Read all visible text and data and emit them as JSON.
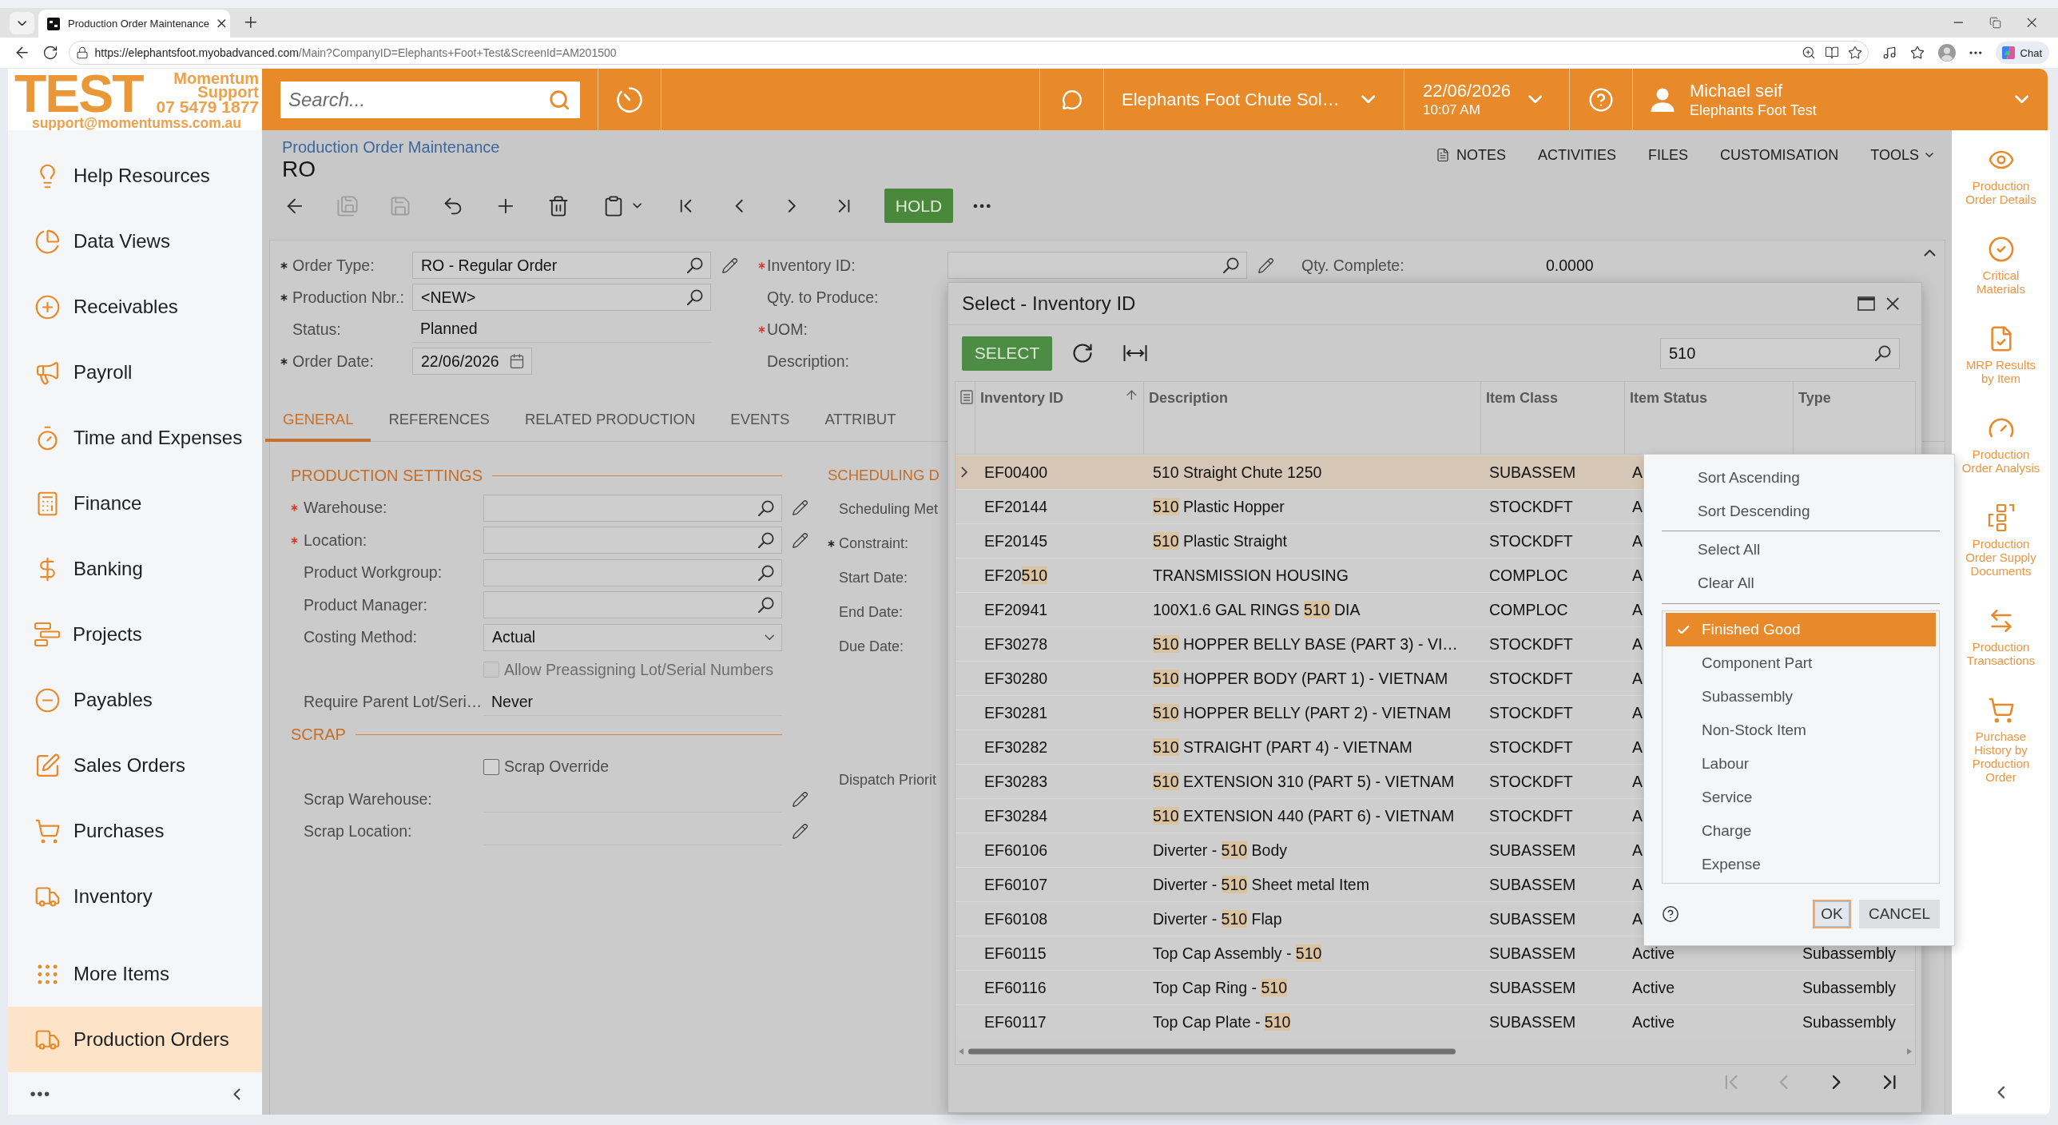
{
  "browser": {
    "tab": {
      "title": "Production Order Maintenance",
      "selected": true
    },
    "address": {
      "host": "https://elephantsfoot.myobadvanced.com",
      "path": "/Main?CompanyID=Elephants+Foot+Test&ScreenId=AM201500"
    },
    "chat_button": "Chat"
  },
  "logo": {
    "wordmark": "TEST",
    "lines": [
      "Momentum",
      "Support",
      "07 5479 1877"
    ],
    "email": "support@momentumss.com.au"
  },
  "top_bar": {
    "search": {
      "placeholder": "Search..."
    },
    "company": "Elephants Foot Chute Sol…",
    "date": "22/06/2026",
    "time": "10:07 AM",
    "user": {
      "name": "Michael seif",
      "company": "Elephants Foot Test"
    }
  },
  "sidebar": {
    "items": [
      {
        "label": "Help Resources",
        "selected": false
      },
      {
        "label": "Data Views",
        "selected": false
      },
      {
        "label": "Receivables",
        "selected": false
      },
      {
        "label": "Payroll",
        "selected": false
      },
      {
        "label": "Time and Expenses",
        "selected": false
      },
      {
        "label": "Finance",
        "selected": false
      },
      {
        "label": "Banking",
        "selected": false
      },
      {
        "label": "Projects",
        "selected": false
      },
      {
        "label": "Payables",
        "selected": false
      },
      {
        "label": "Sales Orders",
        "selected": false
      },
      {
        "label": "Purchases",
        "selected": false
      },
      {
        "label": "Inventory",
        "selected": false
      }
    ],
    "bottom_items": [
      {
        "label": "More Items",
        "selected": false
      },
      {
        "label": "Production Orders",
        "selected": true
      }
    ]
  },
  "screen": {
    "breadcrumb": "Production Order Maintenance",
    "title": "RO",
    "links": [
      {
        "label": "NOTES",
        "has_menu": false
      },
      {
        "label": "ACTIVITIES",
        "has_menu": false
      },
      {
        "label": "FILES",
        "has_menu": false
      },
      {
        "label": "CUSTOMISATION",
        "has_menu": false
      },
      {
        "label": "TOOLS",
        "has_menu": true
      }
    ],
    "toolbar": {
      "buttons": [
        {
          "disabled": false
        },
        {
          "disabled": true
        },
        {
          "disabled": true
        },
        {
          "disabled": false
        },
        {
          "disabled": false
        },
        {
          "disabled": false
        },
        {
          "disabled": false
        },
        {
          "disabled": false
        },
        {
          "disabled": false
        },
        {
          "disabled": false
        },
        {
          "disabled": false
        }
      ],
      "hold_button": "HOLD"
    },
    "header": {
      "columns": [
        {
          "fields": [
            {
              "label": "Order Type:",
              "required": true,
              "missing": false,
              "kind": "lookup",
              "value": "RO - Regular Order",
              "edit": true
            },
            {
              "label": "Production Nbr.:",
              "required": true,
              "missing": false,
              "kind": "lookup",
              "value": "<NEW>",
              "edit": false
            },
            {
              "label": "Status:",
              "required": false,
              "kind": "text",
              "value": "Planned",
              "edit": false
            },
            {
              "label": "Order Date:",
              "required": true,
              "missing": false,
              "kind": "date",
              "value": "22/06/2026",
              "edit": false
            }
          ]
        },
        {
          "fields": [
            {
              "label": "Inventory ID:",
              "required": true,
              "missing": true,
              "kind": "lookup",
              "edit": true
            },
            {
              "label": "Qty. to Produce:",
              "required": false,
              "kind": "label",
              "edit": false
            },
            {
              "label": "UOM:",
              "required": true,
              "missing": true,
              "kind": "label",
              "edit": false
            },
            {
              "label": "Description:",
              "required": false,
              "kind": "label",
              "edit": false
            }
          ]
        },
        {
          "fields": [
            {
              "label": "Qty. Complete:",
              "required": false,
              "kind": "value",
              "value": "0.0000",
              "edit": false
            }
          ]
        }
      ]
    },
    "tabs": [
      {
        "label": "GENERAL",
        "selected": true
      },
      {
        "label": "REFERENCES",
        "selected": false
      },
      {
        "label": "RELATED PRODUCTION",
        "selected": false
      },
      {
        "label": "EVENTS",
        "selected": false
      },
      {
        "label": "ATTRIBUT",
        "selected": false
      }
    ],
    "general": {
      "sections": [
        {
          "title": "PRODUCTION SETTINGS",
          "fields": [
            {
              "label": "Warehouse:",
              "required": true,
              "missing": true,
              "kind": "lookup",
              "edit": true
            },
            {
              "label": "Location:",
              "required": true,
              "missing": true,
              "kind": "lookup",
              "edit": true
            },
            {
              "label": "Product Workgroup:",
              "required": false,
              "kind": "lookup",
              "edit": false
            },
            {
              "label": "Product Manager:",
              "required": false,
              "kind": "lookup",
              "edit": false
            },
            {
              "label": "Costing Method:",
              "required": false,
              "kind": "select",
              "value": "Actual",
              "edit": false
            },
            {
              "label": "Allow Preassigning Lot/Serial Numbers",
              "required": false,
              "kind": "checkbox",
              "checked": false,
              "disabled": true,
              "edit": false
            },
            {
              "label": "Require Parent Lot/Seri…",
              "required": false,
              "kind": "text",
              "value": "Never",
              "edit": false
            }
          ]
        },
        {
          "title": "SCRAP",
          "fields": [
            {
              "label": "Scrap Override",
              "required": false,
              "kind": "checkbox",
              "checked": false,
              "disabled": false,
              "edit": false
            },
            {
              "label": "Scrap Warehouse:",
              "required": false,
              "kind": "text",
              "edit": true
            },
            {
              "label": "Scrap Location:",
              "required": false,
              "kind": "text",
              "edit": true
            }
          ]
        }
      ],
      "scheduling": {
        "title": "SCHEDULING D",
        "fields": [
          {
            "label": "Scheduling Met",
            "required": false
          },
          {
            "label": "Constraint:",
            "required": true,
            "missing": false
          },
          {
            "label": "Start Date:",
            "required": false
          },
          {
            "label": "End Date:",
            "required": false
          },
          {
            "label": "Due Date:",
            "required": false
          }
        ],
        "lower_fields": [
          {
            "label": "Dispatch Priorit",
            "required": false
          }
        ]
      }
    }
  },
  "dialog": {
    "title": "Select - Inventory ID",
    "select_button": "SELECT",
    "search": {
      "value": "510"
    },
    "columns": [
      {
        "label": "Inventory ID",
        "sorted": true
      },
      {
        "label": "Description",
        "sorted": false
      },
      {
        "label": "Item Class",
        "sorted": false
      },
      {
        "label": "Item Status",
        "sorted": false
      },
      {
        "label": "Type",
        "sorted": false
      }
    ],
    "rows": [
      {
        "selected": true,
        "inventory_id": "EF00400",
        "description": "510 Straight Chute 1250",
        "item_class": "SUBASSEM",
        "item_status": "A"
      },
      {
        "selected": false,
        "inventory_id": "EF20144",
        "description": [
          {
            "text": "510",
            "highlighted": true
          },
          {
            "text": " Plastic Hopper",
            "highlighted": false
          }
        ],
        "item_class": "STOCKDFT",
        "item_status": "A"
      },
      {
        "selected": false,
        "inventory_id": "EF20145",
        "description": [
          {
            "text": "510",
            "highlighted": true
          },
          {
            "text": " Plastic Straight",
            "highlighted": false
          }
        ],
        "item_class": "STOCKDFT",
        "item_status": "A"
      },
      {
        "selected": false,
        "inventory_id": [
          {
            "text": "EF20",
            "highlighted": false
          },
          {
            "text": "510",
            "highlighted": true
          }
        ],
        "description": "TRANSMISSION HOUSING",
        "item_class": "COMPLOC",
        "item_status": "A"
      },
      {
        "selected": false,
        "inventory_id": "EF20941",
        "description": [
          {
            "text": "100X1.6 GAL RINGS ",
            "highlighted": false
          },
          {
            "text": "510",
            "highlighted": true
          },
          {
            "text": " DIA",
            "highlighted": false
          }
        ],
        "item_class": "COMPLOC",
        "item_status": "A"
      },
      {
        "selected": false,
        "inventory_id": "EF30278",
        "description": [
          {
            "text": "510",
            "highlighted": true
          },
          {
            "text": " HOPPER BELLY BASE (PART 3) - VI…",
            "highlighted": false
          }
        ],
        "item_class": "STOCKDFT",
        "item_status": "A"
      },
      {
        "selected": false,
        "inventory_id": "EF30280",
        "description": [
          {
            "text": "510",
            "highlighted": true
          },
          {
            "text": " HOPPER BODY (PART 1) - VIETNAM",
            "highlighted": false
          }
        ],
        "item_class": "STOCKDFT",
        "item_status": "A"
      },
      {
        "selected": false,
        "inventory_id": "EF30281",
        "description": [
          {
            "text": "510",
            "highlighted": true
          },
          {
            "text": " HOPPER BELLY (PART 2) - VIETNAM",
            "highlighted": false
          }
        ],
        "item_class": "STOCKDFT",
        "item_status": "A"
      },
      {
        "selected": false,
        "inventory_id": "EF30282",
        "description": [
          {
            "text": "510",
            "highlighted": true
          },
          {
            "text": " STRAIGHT (PART 4) - VIETNAM",
            "highlighted": false
          }
        ],
        "item_class": "STOCKDFT",
        "item_status": "A"
      },
      {
        "selected": false,
        "inventory_id": "EF30283",
        "description": [
          {
            "text": "510",
            "highlighted": true
          },
          {
            "text": " EXTENSION 310 (PART 5) - VIETNAM",
            "highlighted": false
          }
        ],
        "item_class": "STOCKDFT",
        "item_status": "A"
      },
      {
        "selected": false,
        "inventory_id": "EF30284",
        "description": [
          {
            "text": "510",
            "highlighted": true
          },
          {
            "text": " EXTENSION 440 (PART 6) - VIETNAM",
            "highlighted": false
          }
        ],
        "item_class": "STOCKDFT",
        "item_status": "A"
      },
      {
        "selected": false,
        "inventory_id": "EF60106",
        "description": [
          {
            "text": "Diverter - ",
            "highlighted": false
          },
          {
            "text": "510",
            "highlighted": true
          },
          {
            "text": " Body",
            "highlighted": false
          }
        ],
        "item_class": "SUBASSEM",
        "item_status": "A"
      },
      {
        "selected": false,
        "inventory_id": "EF60107",
        "description": [
          {
            "text": "Diverter - ",
            "highlighted": false
          },
          {
            "text": "510",
            "highlighted": true
          },
          {
            "text": " Sheet metal Item",
            "highlighted": false
          }
        ],
        "item_class": "SUBASSEM",
        "item_status": "A"
      },
      {
        "selected": false,
        "inventory_id": "EF60108",
        "description": [
          {
            "text": "Diverter - ",
            "highlighted": false
          },
          {
            "text": "510",
            "highlighted": true
          },
          {
            "text": " Flap",
            "highlighted": false
          }
        ],
        "item_class": "SUBASSEM",
        "item_status": "A"
      },
      {
        "selected": false,
        "inventory_id": "EF60115",
        "description": [
          {
            "text": "Top Cap Assembly - ",
            "highlighted": false
          },
          {
            "text": "510",
            "highlighted": true
          }
        ],
        "item_class": "SUBASSEM",
        "item_status": "Active",
        "type": "Subassembly"
      },
      {
        "selected": false,
        "inventory_id": "EF60116",
        "description": [
          {
            "text": "Top Cap Ring - ",
            "highlighted": false
          },
          {
            "text": "510",
            "highlighted": true
          }
        ],
        "item_class": "SUBASSEM",
        "item_status": "Active",
        "type": "Subassembly"
      },
      {
        "selected": false,
        "inventory_id": "EF60117",
        "description": [
          {
            "text": "Top Cap Plate - ",
            "highlighted": false
          },
          {
            "text": "510",
            "highlighted": true
          }
        ],
        "item_class": "SUBASSEM",
        "item_status": "Active",
        "type": "Subassembly"
      }
    ],
    "pager": [
      {
        "disabled": true
      },
      {
        "disabled": true
      },
      {
        "disabled": false
      },
      {
        "disabled": false
      }
    ],
    "column_menu": {
      "sort_actions": [
        "Sort Ascending",
        "Sort Descending"
      ],
      "selection_actions": [
        "Select All",
        "Clear All"
      ],
      "options": [
        {
          "label": "Finished Good",
          "checked": true
        },
        {
          "label": "Component Part",
          "checked": false
        },
        {
          "label": "Subassembly",
          "checked": false
        },
        {
          "label": "Non-Stock Item",
          "checked": false
        },
        {
          "label": "Labour",
          "checked": false
        },
        {
          "label": "Service",
          "checked": false
        },
        {
          "label": "Charge",
          "checked": false
        },
        {
          "label": "Expense",
          "checked": false
        }
      ],
      "ok_button": "OK",
      "cancel_button": "CANCEL"
    }
  },
  "side_panel": {
    "items": [
      {
        "label": "Production Order Details"
      },
      {
        "label": "Critical Materials"
      },
      {
        "label": "MRP Results by Item"
      },
      {
        "label": "Production Order Analysis"
      },
      {
        "label": "Production Order Supply Documents"
      },
      {
        "label": "Production Transactions"
      },
      {
        "label": "Purchase History by Production Order"
      }
    ]
  }
}
